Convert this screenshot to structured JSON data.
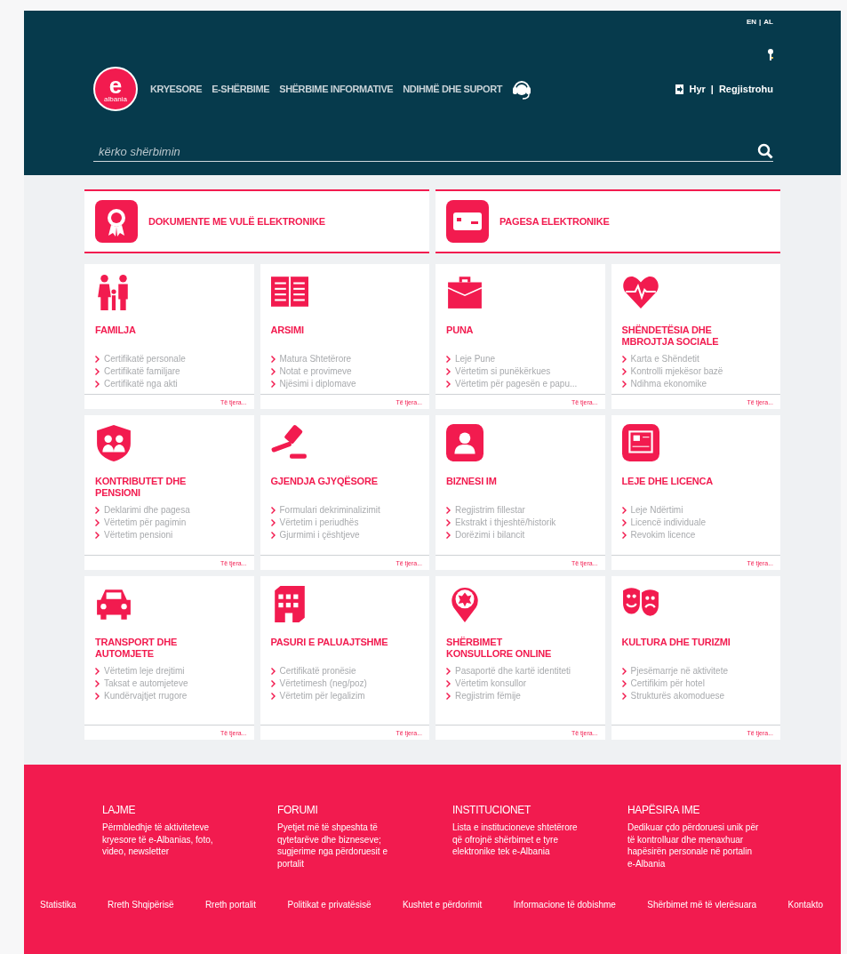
{
  "header": {
    "languages": [
      "EN",
      "AL"
    ],
    "separator": "|",
    "logo": {
      "letter": "e",
      "sub": "albania"
    },
    "nav": [
      "KRYESORE",
      "E-SHËRBIME",
      "SHËRBIME INFORMATIVE",
      "NDIHMË DHE SUPORT"
    ],
    "auth": [
      "Hyr",
      "Regjistrohu"
    ],
    "search": {
      "placeholder": "kërko shërbimin"
    }
  },
  "featured": [
    "DOKUMENTE ME VULË ELEKTRONIKE",
    "PAGESA ELEKTRONIKE"
  ],
  "categories": [
    {
      "title": "FAMILJA",
      "items": [
        "Certifikatë personale",
        "Certifikatë familjare",
        "Certifikatë nga akti"
      ],
      "more": "Të tjera..."
    },
    {
      "title": "ARSIMI",
      "items": [
        "Matura Shtetërore",
        "Notat e provimeve",
        "Njësimi i diplomave"
      ],
      "more": "Të tjera..."
    },
    {
      "title": "PUNA",
      "items": [
        "Leje Pune",
        "Vërtetim si punëkërkues",
        "Vërtetim për pagesën e papu..."
      ],
      "more": "Të tjera..."
    },
    {
      "title": "SHËNDETËSIA DHE MBROJTJA SOCIALE",
      "items": [
        "Karta e Shëndetit",
        "Kontrolli mjekësor bazë",
        "Ndihma ekonomike"
      ],
      "more": "Të tjera..."
    },
    {
      "title": "KONTRIBUTET DHE PENSIONI",
      "items": [
        "Deklarimi dhe pagesa",
        "Vërtetim për pagimin",
        "Vërtetim pensioni"
      ],
      "more": "Të tjera..."
    },
    {
      "title": "GJENDJA GJYQËSORE",
      "items": [
        "Formulari dekriminalizimit",
        "Vërtetim i periudhës",
        "Gjurmimi i çështjeve"
      ],
      "more": "Të tjera..."
    },
    {
      "title": "BIZNESI IM",
      "items": [
        "Regjistrim fillestar",
        "Ekstrakt i thjeshtë/historik",
        "Dorëzimi i bilancit"
      ],
      "more": "Të tjera..."
    },
    {
      "title": "LEJE DHE LICENCA",
      "items": [
        "Leje Ndërtimi",
        "Licencë individuale",
        "Revokim licence"
      ],
      "more": "Të tjera..."
    },
    {
      "title": "TRANSPORT DHE AUTOMJETE",
      "items": [
        "Vërtetim leje drejtimi",
        "Taksat e automjeteve",
        "Kundërvajtjet rrugore"
      ],
      "more": "Të tjera..."
    },
    {
      "title": "PASURI E PALUAJTSHME",
      "items": [
        "Certifikatë pronësie",
        "Vërtetimesh (neg/poz)",
        "Vërtetim për legalizim"
      ],
      "more": "Të tjera..."
    },
    {
      "title": "SHËRBIMET KONSULLORE ONLINE",
      "items": [
        "Pasaportë dhe kartë identiteti",
        "Vërtetim konsullor",
        "Regjistrim fëmije"
      ],
      "more": "Të tjera..."
    },
    {
      "title": "KULTURA DHE TURIZMI",
      "items": [
        "Pjesëmarrje në aktivitete",
        "Certifikim për hotel",
        "Strukturës akomoduese"
      ],
      "more": "Të tjera..."
    }
  ],
  "footer": {
    "columns": [
      {
        "title": "LAJME",
        "text": "Përmbledhje të aktiviteteve kryesore të e-Albanias, foto, video, newsletter"
      },
      {
        "title": "FORUMI",
        "text": "Pyetjet më të shpeshta të qytetarëve dhe bizneseve; sugjerime nga përdoruesit e portalit"
      },
      {
        "title": "INSTITUCIONET",
        "text": "Lista e institucioneve shtetërore që ofrojnë shërbimet e tyre elektronike tek e-Albania"
      },
      {
        "title": "HAPËSIRA IME",
        "text": "Dedikuar çdo përdoruesi unik për të kontrolluar dhe menaxhuar hapësirën personale në portalin e-Albania"
      }
    ],
    "links": [
      "Statistika",
      "Rreth Shqipërisë",
      "Rreth portalit",
      "Politikat e privatësisë",
      "Kushtet e përdorimit",
      "Informacione të dobishme",
      "Shërbimet më të vlerësuara",
      "Kontakto"
    ]
  }
}
